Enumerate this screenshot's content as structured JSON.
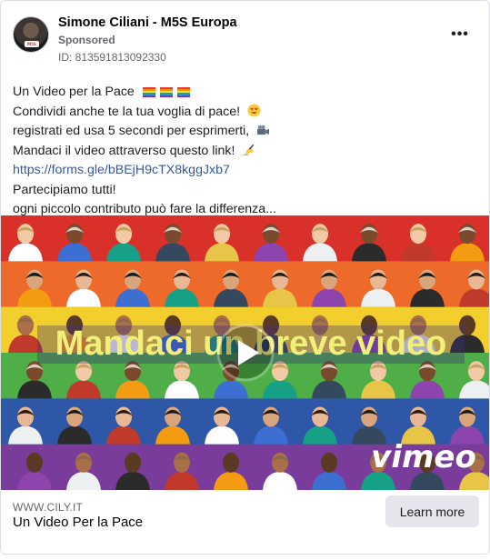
{
  "ad": {
    "page_name": "Simone Ciliani - M5S Europa",
    "sponsored_label": "Sponsored",
    "ad_id": "ID: 813591813092330",
    "more_icon": "more-horizontal-icon",
    "avatar_badge": "M5S"
  },
  "body_lines": {
    "l1": "Un Video per la Pace",
    "l2": "Condividi anche te la tua voglia di pace!",
    "l3": "registrati ed usa 5 secondi per esprimerti,",
    "l4": "Mandaci il video attraverso questo link!",
    "l5": "https://forms.gle/bBEjH9cTX8kggJxb7",
    "l6": "Partecipiamo tutti!",
    "l7": "ogni piccolo contributo può fare la differenza..."
  },
  "media": {
    "overlay_text": "Mandaci un breve video",
    "brand_text": "vimeo",
    "play_icon": "play-icon",
    "stripe_colors": [
      "#d9302a",
      "#ee6a2a",
      "#f3cf2e",
      "#4fae47",
      "#2e57a8",
      "#7a3c9a"
    ]
  },
  "footer": {
    "domain": "WWW.CILY.IT",
    "headline": "Un Video Per la Pace",
    "cta_label": "Learn more"
  }
}
